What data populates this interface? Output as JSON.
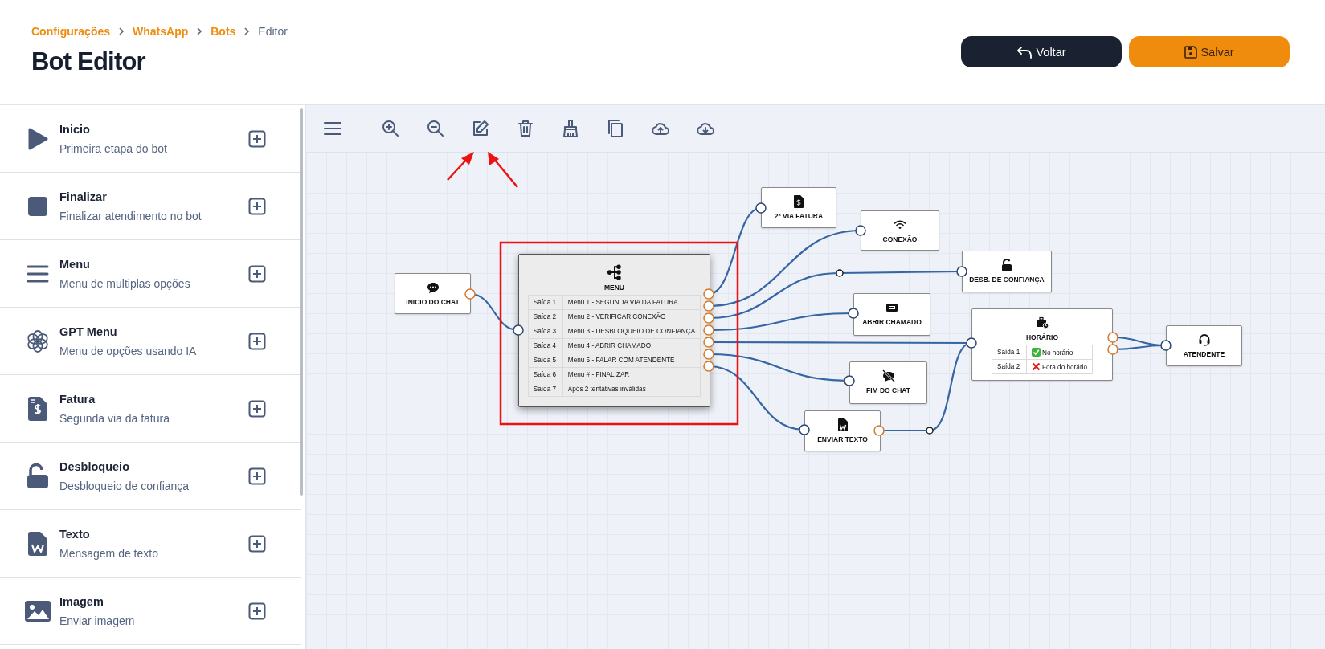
{
  "breadcrumb": [
    {
      "label": "Configurações",
      "current": false
    },
    {
      "label": "WhatsApp",
      "current": false
    },
    {
      "label": "Bots",
      "current": false
    },
    {
      "label": "Editor",
      "current": true
    }
  ],
  "title": "Bot Editor",
  "actions": [
    {
      "kind": "back",
      "label": "Voltar"
    },
    {
      "kind": "save",
      "label": "Salvar"
    }
  ],
  "sidebar": {
    "items": [
      {
        "kind": "start",
        "title": "Inicio",
        "subtitle": "Primeira etapa do bot"
      },
      {
        "kind": "end",
        "title": "Finalizar",
        "subtitle": "Finalizar atendimento no bot"
      },
      {
        "kind": "menu",
        "title": "Menu",
        "subtitle": "Menu de multiplas opções"
      },
      {
        "kind": "gpt",
        "title": "GPT Menu",
        "subtitle": "Menu de opções usando IA"
      },
      {
        "kind": "invoice",
        "title": "Fatura",
        "subtitle": "Segunda via da fatura"
      },
      {
        "kind": "unlock",
        "title": "Desbloqueio",
        "subtitle": "Desbloqueio de confiança"
      },
      {
        "kind": "text",
        "title": "Texto",
        "subtitle": "Mensagem de texto"
      },
      {
        "kind": "image",
        "title": "Imagem",
        "subtitle": "Enviar imagem"
      }
    ]
  },
  "toolbar": {
    "tools": [
      {
        "kind": "menu"
      },
      {
        "kind": "zoom-in"
      },
      {
        "kind": "zoom-out"
      },
      {
        "kind": "edit"
      },
      {
        "kind": "delete"
      },
      {
        "kind": "clear"
      },
      {
        "kind": "copy"
      },
      {
        "kind": "upload"
      },
      {
        "kind": "download"
      }
    ]
  },
  "canvas": {
    "nodes": [
      {
        "kind": "start",
        "title": "INICIO DO CHAT"
      },
      {
        "kind": "menu",
        "title": "MENU",
        "rows": [
          {
            "label": "Saída 1",
            "value": "Menu 1 - SEGUNDA VIA DA FATURA"
          },
          {
            "label": "Saída 2",
            "value": "Menu 2 - VERIFICAR CONEXÃO"
          },
          {
            "label": "Saída 3",
            "value": "Menu 3 - DESBLOQUEIO DE CONFIANÇA"
          },
          {
            "label": "Saída 4",
            "value": "Menu 4 - ABRIR CHAMADO"
          },
          {
            "label": "Saída 5",
            "value": "Menu 5 - FALAR COM ATENDENTE"
          },
          {
            "label": "Saída 6",
            "value": "Menu # - FINALIZAR"
          },
          {
            "label": "Saída 7",
            "value": "Após 2 tentativas inválidas"
          }
        ]
      },
      {
        "kind": "invoice",
        "title": "2ª VIA FATURA"
      },
      {
        "kind": "connection",
        "title": "CONEXÃO"
      },
      {
        "kind": "unlock",
        "title": "DESB. DE CONFIANÇA"
      },
      {
        "kind": "ticket",
        "title": "ABRIR CHAMADO"
      },
      {
        "kind": "schedule",
        "title": "HORÁRIO",
        "rows": [
          {
            "label": "Saída 1",
            "value": "No horário",
            "kind": "yes"
          },
          {
            "label": "Saída 2",
            "value": "Fora do horário",
            "kind": "no"
          }
        ]
      },
      {
        "kind": "agent",
        "title": "ATENDENTE"
      },
      {
        "kind": "end-chat",
        "title": "FIM DO CHAT"
      },
      {
        "kind": "text",
        "title": "ENVIAR TEXTO"
      }
    ]
  }
}
